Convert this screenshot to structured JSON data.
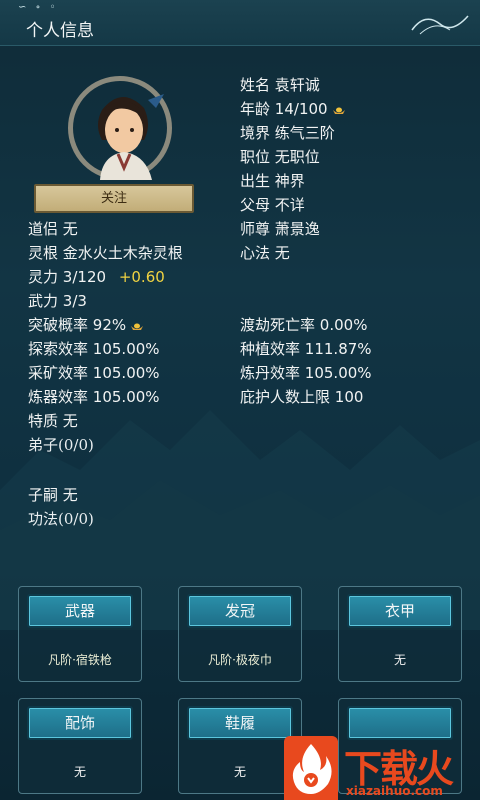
{
  "header": {
    "title": "个人信息"
  },
  "profile": {
    "follow_label": "关注",
    "name_k": "姓名",
    "name_v": "袁轩诚",
    "age_k": "年龄",
    "age_v": "14/100",
    "realm_k": "境界",
    "realm_v": "练气三阶",
    "position_k": "职位",
    "position_v": "无职位",
    "birth_k": "出生",
    "birth_v": "神界",
    "parents_k": "父母",
    "parents_v": "不详",
    "master_k": "师尊",
    "master_v": "萧景逸",
    "partner_k": "道侣",
    "partner_v": "无",
    "root_k": "灵根",
    "root_v": "金水火土木杂灵根",
    "method_k": "心法",
    "method_v": "无",
    "spirit_k": "灵力",
    "spirit_v": "3/120",
    "spirit_rate": "+0.60",
    "martial_k": "武力",
    "martial_v": "3/3",
    "breakthrough_k": "突破概率",
    "breakthrough_v": "92%",
    "tribulation_k": "渡劫死亡率",
    "tribulation_v": "0.00%",
    "explore_k": "探索效率",
    "explore_v": "105.00%",
    "plant_k": "种植效率",
    "plant_v": "111.87%",
    "mining_k": "采矿效率",
    "mining_v": "105.00%",
    "alchemy_k": "炼丹效率",
    "alchemy_v": "105.00%",
    "forge_k": "炼器效率",
    "forge_v": "105.00%",
    "shelter_k": "庇护人数上限",
    "shelter_v": "100",
    "trait_k": "特质",
    "trait_v": "无",
    "disciples": "弟子(0/0)",
    "heir_k": "子嗣",
    "heir_v": "无",
    "skills": "功法(0/0)"
  },
  "equipment": [
    {
      "btn": "武器",
      "item": "凡阶·宿铁枪"
    },
    {
      "btn": "发冠",
      "item": "凡阶·极夜巾"
    },
    {
      "btn": "衣甲",
      "item": "无"
    },
    {
      "btn": "配饰",
      "item": "无"
    },
    {
      "btn": "鞋履",
      "item": "无"
    },
    {
      "btn": "",
      "item": ""
    }
  ],
  "watermark": {
    "text": "下载火",
    "url": "xiazaihuo.com"
  },
  "colors": {
    "highlight": "#f0d342",
    "button": "#2a8fa9",
    "follow": "#d7c79b"
  }
}
